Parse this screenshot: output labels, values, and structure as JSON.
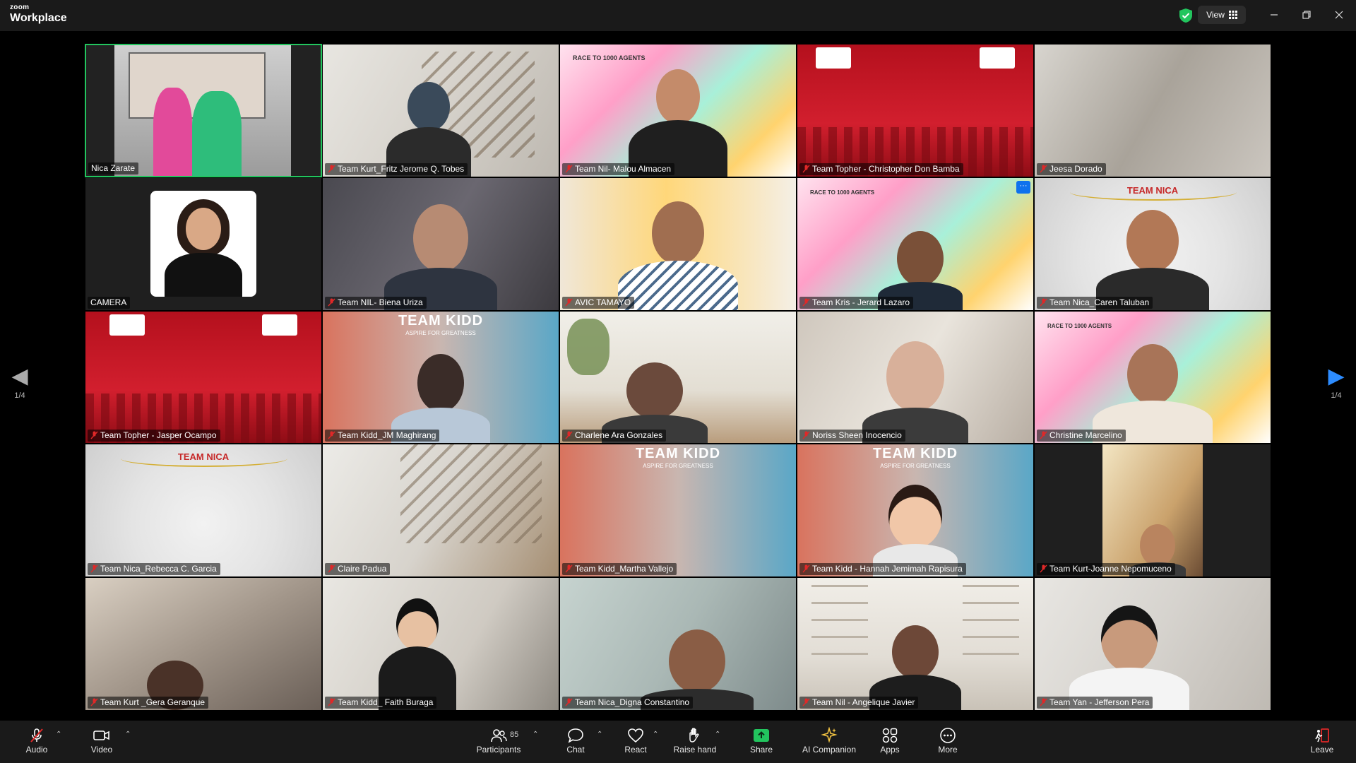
{
  "app": {
    "brand_small": "zoom",
    "brand_big": "Workplace",
    "view_label": "View"
  },
  "colors": {
    "active_speaker": "#22c55e",
    "share_green": "#22c55e",
    "leave_red": "#e02828",
    "titlebar": "#1a1a1a"
  },
  "pager": {
    "left": "1/4",
    "right": "1/4"
  },
  "tiles": [
    {
      "name": "Nica Zarate",
      "muted": false
    },
    {
      "name": "Team Kurt_Fritz Jerome Q. Tobes",
      "muted": true
    },
    {
      "name": "Team Nil- Malou Almacen",
      "muted": true
    },
    {
      "name": "Team Topher - Christopher Don Bamba",
      "muted": true
    },
    {
      "name": "Jeesa Dorado",
      "muted": true
    },
    {
      "name": "CAMERA",
      "muted": false
    },
    {
      "name": "Team NIL- Biena Uriza",
      "muted": true
    },
    {
      "name": "AVIC TAMAYO",
      "muted": true
    },
    {
      "name": "Team Kris - Jerard Lazaro",
      "muted": true
    },
    {
      "name": "Team Nica_Caren Taluban",
      "muted": true
    },
    {
      "name": "Team Topher - Jasper Ocampo",
      "muted": true
    },
    {
      "name": "Team Kidd_JM Maghirang",
      "muted": true
    },
    {
      "name": "Charlene Ara Gonzales",
      "muted": true
    },
    {
      "name": "Noriss Sheen Inocencio",
      "muted": true
    },
    {
      "name": "Christine Marcelino",
      "muted": true
    },
    {
      "name": "Team Nica_Rebecca C. Garcia",
      "muted": true
    },
    {
      "name": "Claire Padua",
      "muted": true
    },
    {
      "name": "Team Kidd_Martha Vallejo",
      "muted": true
    },
    {
      "name": "Team Kidd - Hannah Jemimah Rapisura",
      "muted": true
    },
    {
      "name": "Team Kurt-Joanne Nepomuceno",
      "muted": true
    },
    {
      "name": "Team Kurt _Gera Geranque",
      "muted": true
    },
    {
      "name": "Team Kidd_ Faith Buraga",
      "muted": true
    },
    {
      "name": "Team Nica_Digna Constantino",
      "muted": true
    },
    {
      "name": "Team Nil - Angelique Javier",
      "muted": true
    },
    {
      "name": "Team Yan - Jefferson Pera",
      "muted": true
    }
  ],
  "backgrounds": {
    "team_kidd_title": "TEAM KIDD",
    "team_kidd_sub": "ASPIRE FOR GREATNESS",
    "team_nica_title": "TEAM NICA",
    "race_title": "RACE TO 1000 AGENTS"
  },
  "toolbar": {
    "audio": "Audio",
    "video": "Video",
    "participants": "Participants",
    "participants_count": "85",
    "chat": "Chat",
    "react": "React",
    "raise_hand": "Raise hand",
    "share": "Share",
    "ai_companion": "AI Companion",
    "apps": "Apps",
    "more": "More",
    "leave": "Leave"
  }
}
